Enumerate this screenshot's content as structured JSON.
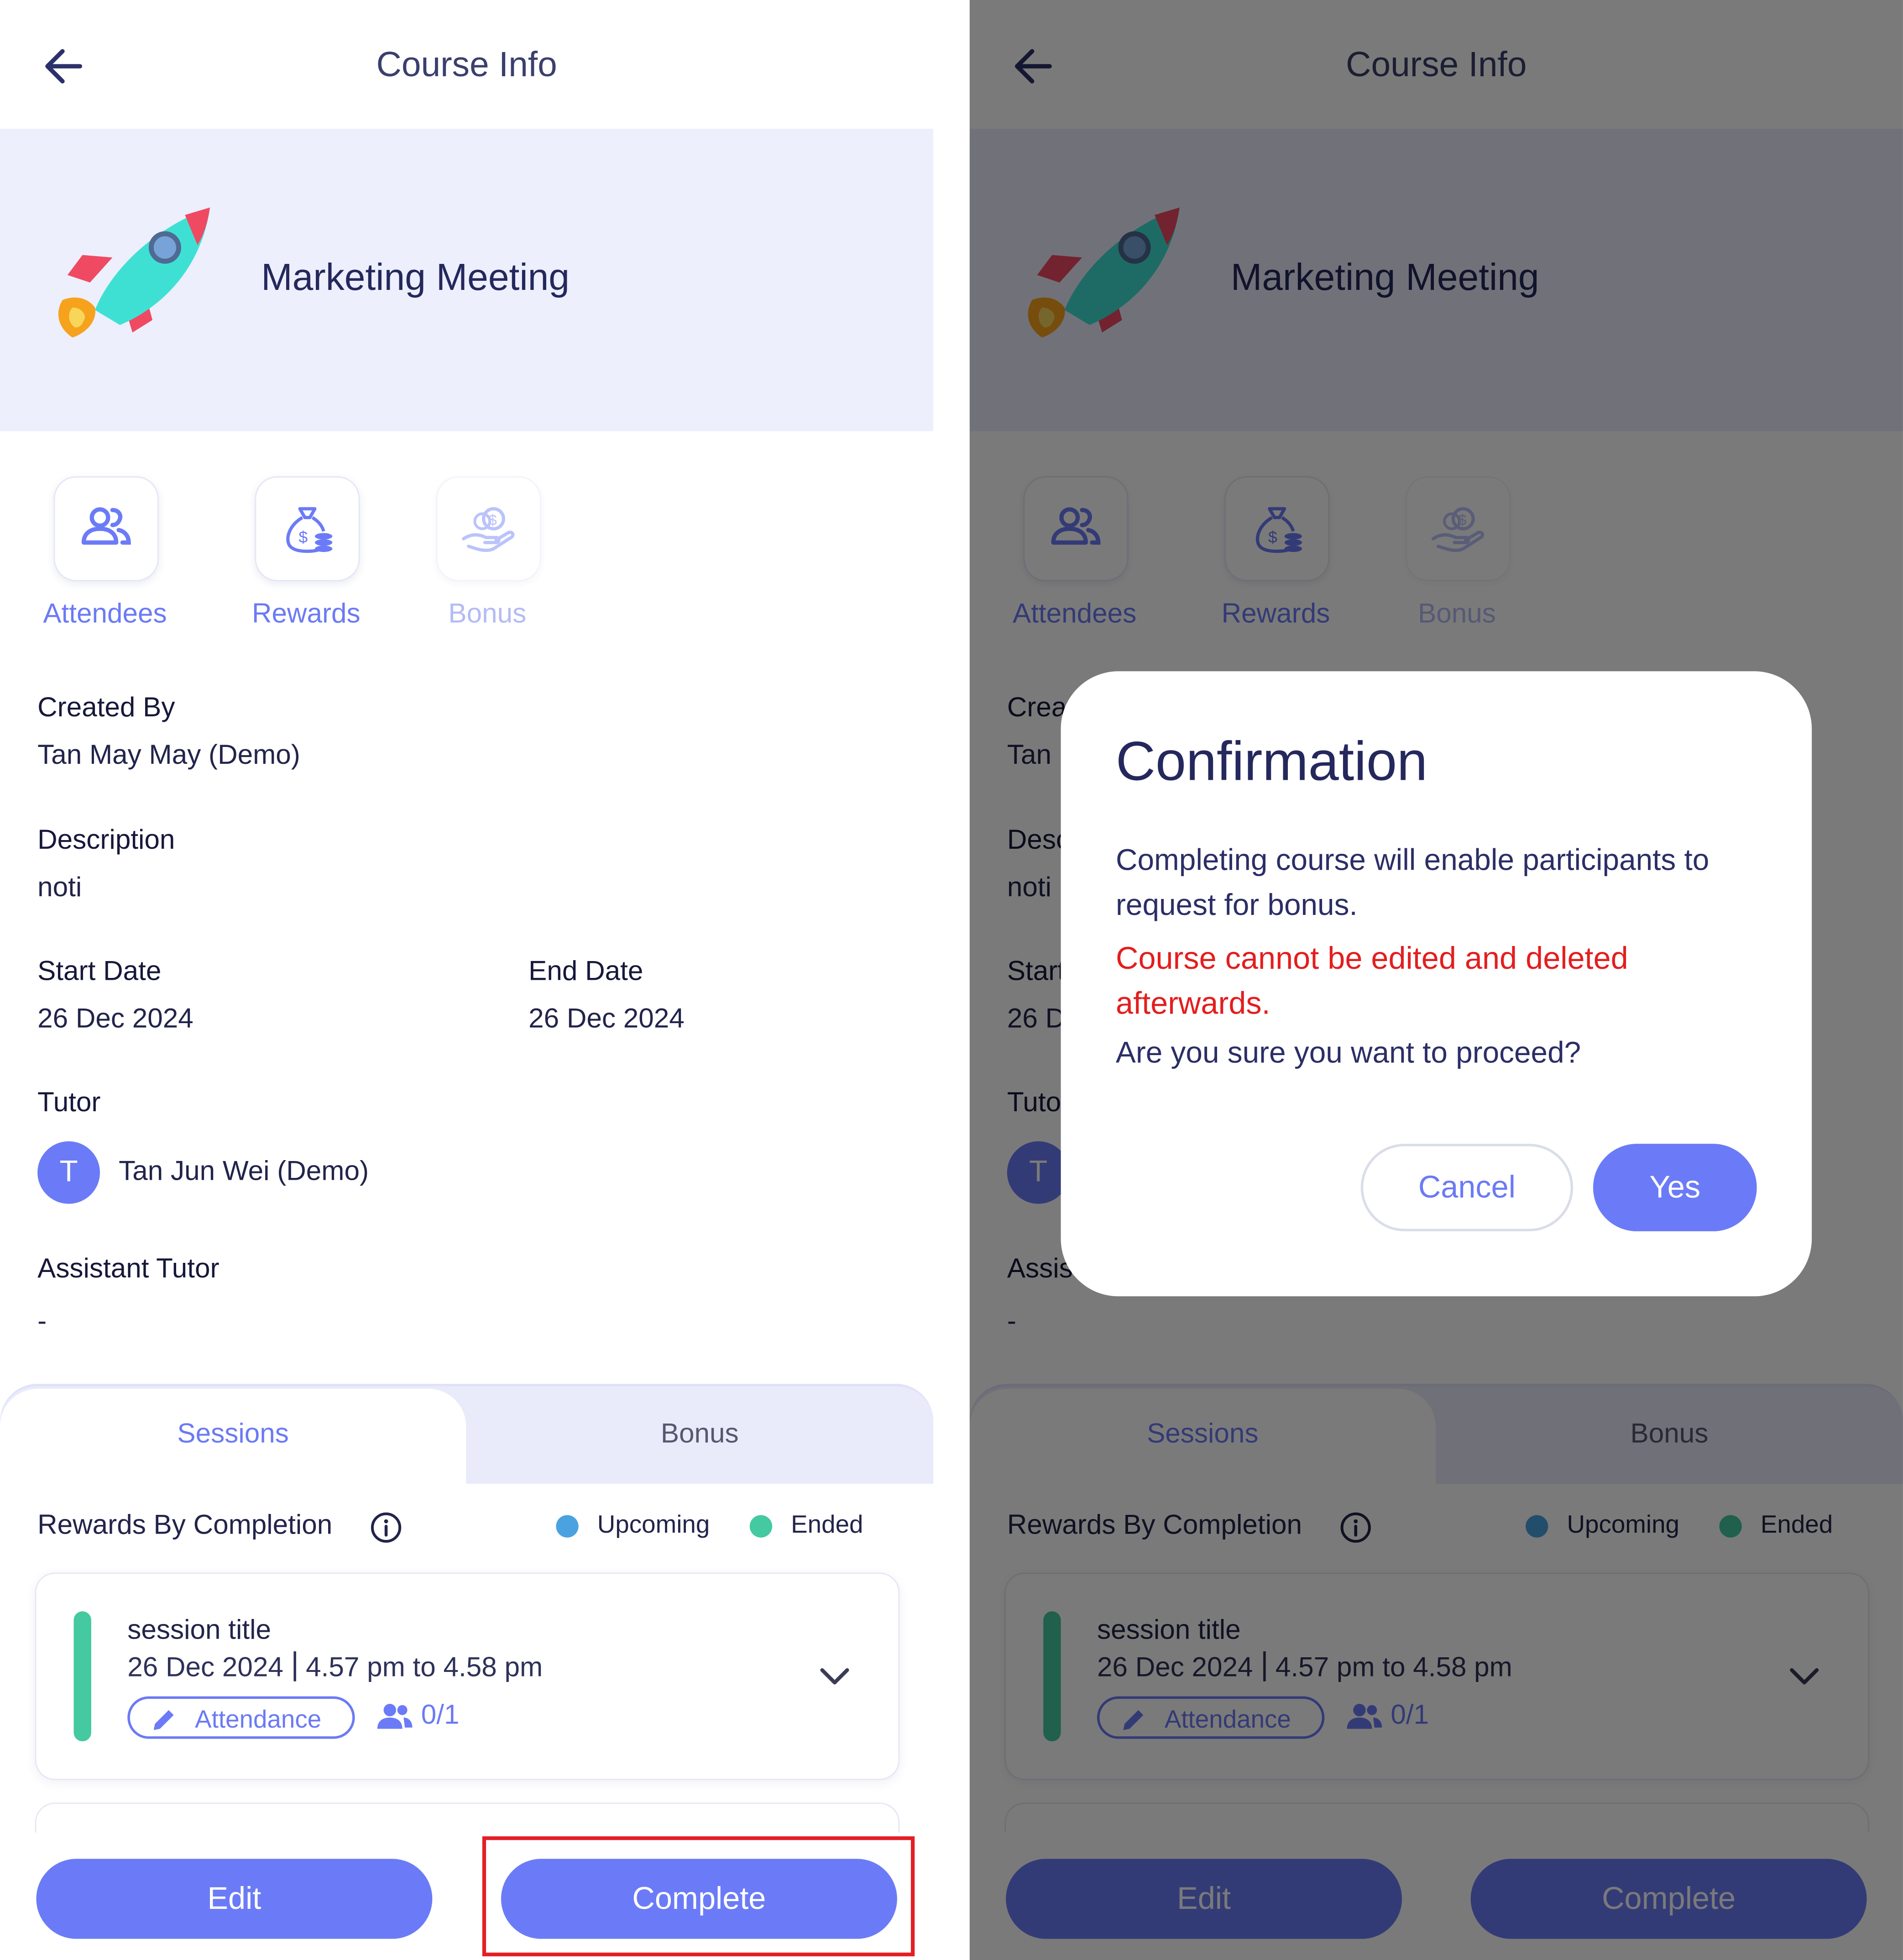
{
  "header": {
    "title": "Course Info"
  },
  "course": {
    "name": "Marketing Meeting"
  },
  "actions": [
    {
      "label": "Attendees",
      "icon": "people-icon",
      "enabled": true
    },
    {
      "label": "Rewards",
      "icon": "money-bag-icon",
      "enabled": true
    },
    {
      "label": "Bonus",
      "icon": "coin-hand-icon",
      "enabled": false
    }
  ],
  "details": {
    "created_by_label": "Created By",
    "created_by": "Tan May May (Demo)",
    "description_label": "Description",
    "description": "noti",
    "start_date_label": "Start Date",
    "start_date": "26 Dec 2024",
    "end_date_label": "End Date",
    "end_date": "26 Dec 2024",
    "tutor_label": "Tutor",
    "tutor_initial": "T",
    "tutor_name": "Tan Jun Wei (Demo)",
    "assistant_label": "Assistant Tutor",
    "assistant": "-"
  },
  "tabs": [
    {
      "label": "Sessions",
      "active": true
    },
    {
      "label": "Bonus",
      "active": false
    }
  ],
  "rewards": {
    "title": "Rewards By Completion",
    "legend": [
      {
        "label": "Upcoming",
        "color": "#4aa3e0"
      },
      {
        "label": "Ended",
        "color": "#44c9a0"
      }
    ]
  },
  "session": {
    "title": "session title",
    "date": "26 Dec 2024",
    "time": "4.57 pm to 4.58 pm",
    "attendance_label": "Attendance",
    "count": "0/1"
  },
  "buttons": {
    "edit": "Edit",
    "complete": "Complete"
  },
  "dialog": {
    "title": "Confirmation",
    "message": "Completing course will enable participants to request for bonus.",
    "warning": "Course cannot be edited and deleted afterwards.",
    "question": "Are you sure you want to proceed?",
    "cancel": "Cancel",
    "yes": "Yes"
  },
  "colors": {
    "accent": "#6b7bf7",
    "warning": "#e31e1e",
    "ended": "#44c9a0",
    "upcoming": "#4aa3e0",
    "highlight": "#e41e25"
  }
}
